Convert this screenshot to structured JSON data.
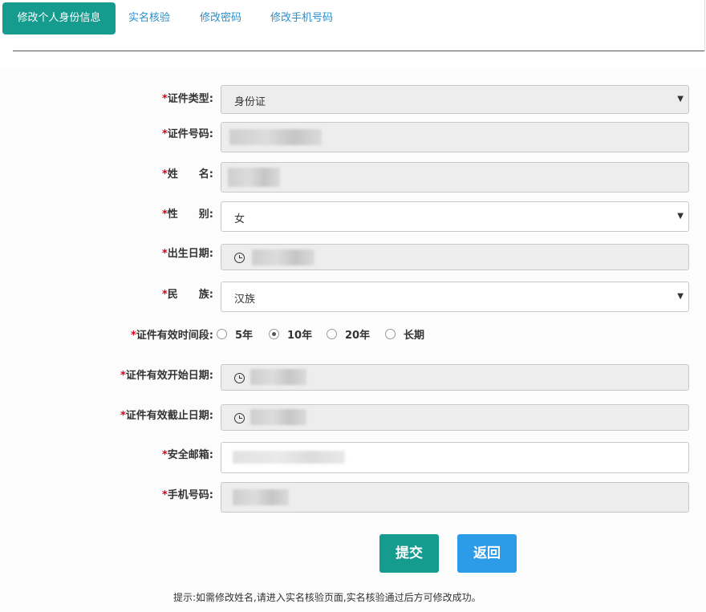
{
  "tabs": [
    {
      "label": "修改个人身份信息",
      "active": true
    },
    {
      "label": "实名核验",
      "active": false
    },
    {
      "label": "修改密码",
      "active": false
    },
    {
      "label": "修改手机号码",
      "active": false
    }
  ],
  "form": {
    "required_mark": "*",
    "id_type": {
      "label": "证件类型:",
      "value": "身份证"
    },
    "id_number": {
      "label": "证件号码:",
      "value": ""
    },
    "name": {
      "label_a": "姓",
      "label_b": "名:",
      "value": ""
    },
    "gender": {
      "label_a": "性",
      "label_b": "别:",
      "value": "女"
    },
    "birth_date": {
      "label": "出生日期:",
      "value": ""
    },
    "ethnicity": {
      "label_a": "民",
      "label_b": "族:",
      "value": "汉族"
    },
    "validity_period": {
      "label": "证件有效时间段:",
      "options": [
        "5年",
        "10年",
        "20年",
        "长期"
      ],
      "selected": "10年"
    },
    "valid_start": {
      "label": "证件有效开始日期:",
      "value": ""
    },
    "valid_end": {
      "label": "证件有效截止日期:",
      "value": ""
    },
    "email": {
      "label": "安全邮箱:",
      "value": ""
    },
    "phone": {
      "label": "手机号码:",
      "value": ""
    }
  },
  "buttons": {
    "submit": "提交",
    "back": "返回"
  },
  "hint": "提示:如需修改姓名,请进入实名核验页面,实名核验通过后方可修改成功。",
  "colors": {
    "primary": "#169b8f",
    "secondary": "#2d9ce8",
    "required": "#d9001b"
  }
}
